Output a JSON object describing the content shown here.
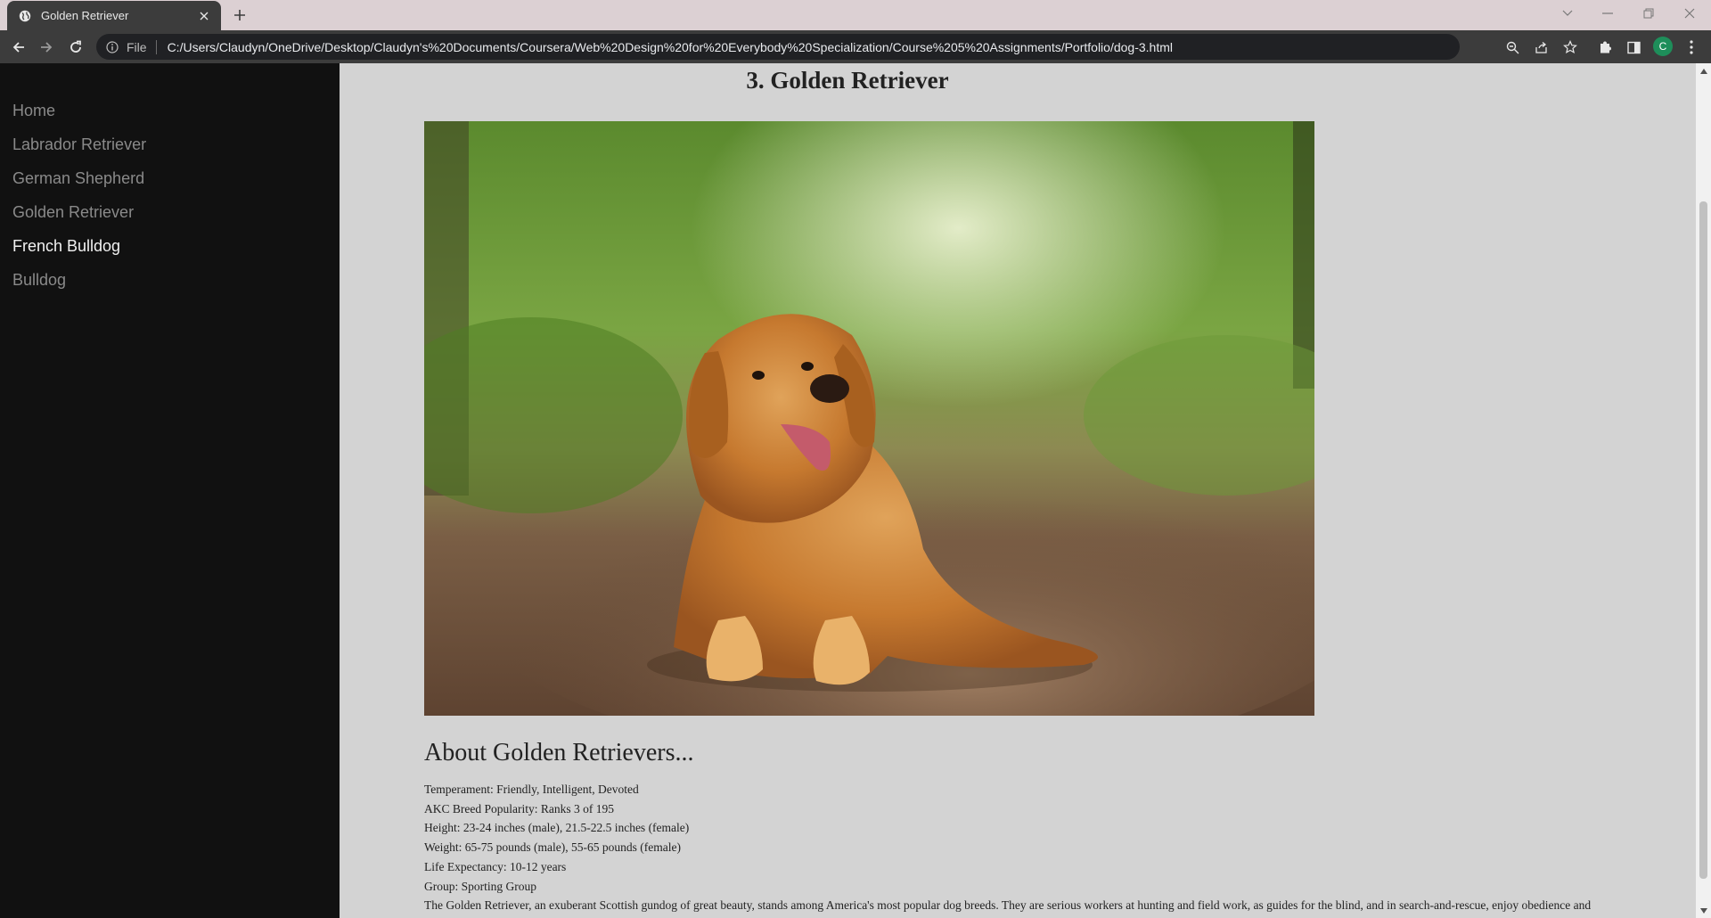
{
  "browser": {
    "tab_title": "Golden Retriever",
    "omnibox_scheme": "File",
    "url": "C:/Users/Claudyn/OneDrive/Desktop/Claudyn's%20Documents/Coursera/Web%20Design%20for%20Everybody%20Specialization/Course%205%20Assignments/Portfolio/dog-3.html",
    "profile_initial": "C"
  },
  "sidebar": {
    "items": [
      {
        "label": "Home"
      },
      {
        "label": "Labrador Retriever"
      },
      {
        "label": "German Shepherd"
      },
      {
        "label": "Golden Retriever"
      },
      {
        "label": "French Bulldog"
      },
      {
        "label": "Bulldog"
      }
    ]
  },
  "main": {
    "title": "3. Golden Retriever",
    "about_heading": "About Golden Retrievers...",
    "facts": [
      "Temperament: Friendly, Intelligent, Devoted",
      "AKC Breed Popularity: Ranks 3 of 195",
      "Height: 23-24 inches (male), 21.5-22.5 inches (female)",
      "Weight: 65-75 pounds (male), 55-65 pounds (female)",
      "Life Expectancy: 10-12 years",
      "Group: Sporting Group",
      "The Golden Retriever, an exuberant Scottish gundog of great beauty, stands among America's most popular dog breeds. They are serious workers at hunting and field work, as guides for the blind, and in search-and-rescue, enjoy obedience and"
    ]
  },
  "colors": {
    "page_background": "#d3d3d3",
    "sidebar_background": "#111111",
    "sidebar_link": "#8a8a8a",
    "sidebar_link_active": "#f1f1f1",
    "browser_toolbar": "#3c3c3c",
    "tabstrip": "#dcd0d3"
  },
  "icons": [
    "globe-icon",
    "close-icon",
    "plus-icon",
    "back-arrow-icon",
    "forward-arrow-icon",
    "reload-icon",
    "info-icon",
    "zoom-icon",
    "share-icon",
    "star-icon",
    "extensions-icon",
    "side-panel-icon",
    "menu-dots-icon",
    "chevron-down-icon",
    "minimize-icon",
    "restore-icon"
  ]
}
